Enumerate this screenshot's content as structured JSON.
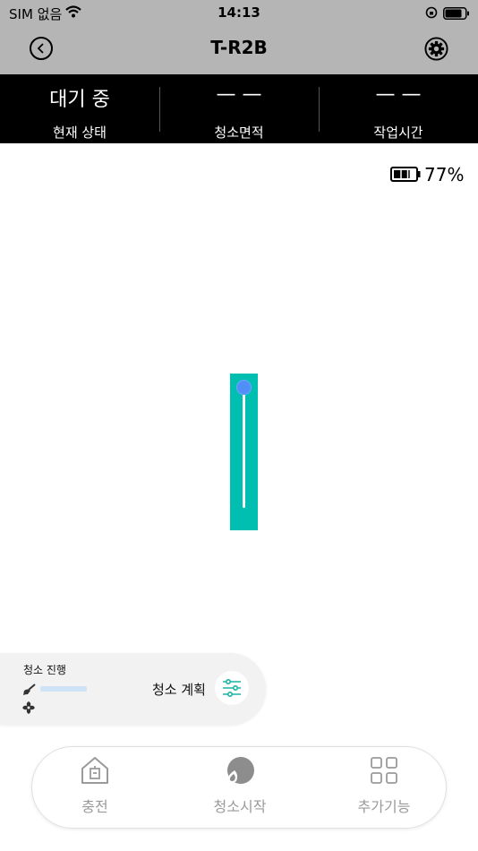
{
  "status_bar": {
    "carrier": "SIM 없음",
    "time": "14:13"
  },
  "nav": {
    "title": "T-R2B"
  },
  "stats": [
    {
      "value": "대기 중",
      "label": "현재 상태"
    },
    {
      "value": "— —",
      "label": "청소면적"
    },
    {
      "value": "— —",
      "label": "작업시간"
    }
  ],
  "battery": {
    "percent_text": "77%",
    "level": 0.77
  },
  "progress_panel": {
    "title": "청소 진행",
    "plan_label": "청소 계획"
  },
  "bottom_nav": [
    {
      "label": "충전",
      "icon": "home-charge-icon"
    },
    {
      "label": "청소시작",
      "icon": "start-clean-icon"
    },
    {
      "label": "추가기능",
      "icon": "grid-apps-icon"
    }
  ],
  "colors": {
    "header_bg": "#b5b5b5",
    "stats_bg": "#000000",
    "map_fill": "#00bfb1",
    "robot_marker": "#4f8ff7",
    "accent_teal": "#1ab3a6",
    "nav_label": "#9a9a9a"
  }
}
